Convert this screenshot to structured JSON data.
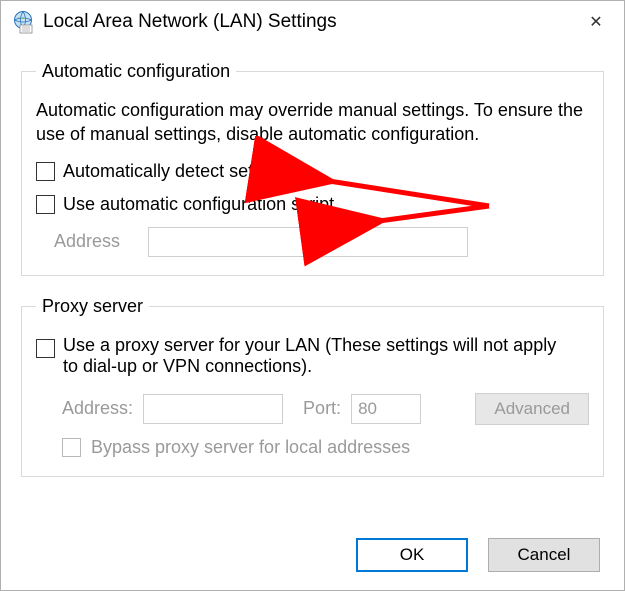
{
  "window": {
    "title": "Local Area Network (LAN) Settings",
    "close_label": "✕"
  },
  "autoconfig": {
    "legend": "Automatic configuration",
    "description": "Automatic configuration may override manual settings.  To ensure the use of manual settings, disable automatic configuration.",
    "auto_detect_label": "Automatically detect settings",
    "use_script_label": "Use automatic configuration script",
    "address_label": "Address",
    "address_value": ""
  },
  "proxy": {
    "legend": "Proxy server",
    "use_proxy_label": "Use a proxy server for your LAN (These settings will not apply to dial-up or VPN connections).",
    "address_label": "Address:",
    "address_value": "",
    "port_label": "Port:",
    "port_value": "80",
    "advanced_label": "Advanced",
    "bypass_label": "Bypass proxy server for local addresses"
  },
  "buttons": {
    "ok": "OK",
    "cancel": "Cancel"
  }
}
